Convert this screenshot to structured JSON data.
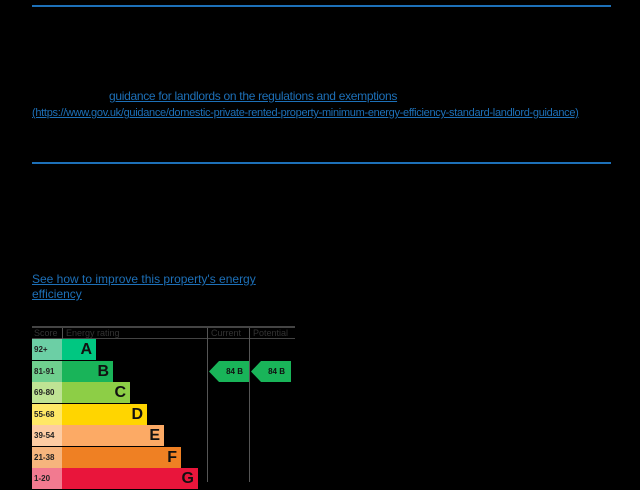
{
  "guidance": {
    "link_text": "guidance for landlords on the regulations and exemptions",
    "url_text": "(https://www.gov.uk/guidance/domestic-private-rented-property-minimum-energy-efficiency-standard-landlord-guidance)"
  },
  "improve_link": "See how to improve this property's energy efficiency",
  "epc": {
    "headers": {
      "score": "Score",
      "rating": "Energy rating",
      "current": "Current",
      "potential": "Potential"
    },
    "bands": [
      {
        "score": "92+",
        "letter": "A",
        "color": "#00c781",
        "light": "#6ccfa5"
      },
      {
        "score": "81-91",
        "letter": "B",
        "color": "#19b459",
        "light": "#6fcf8e"
      },
      {
        "score": "69-80",
        "letter": "C",
        "color": "#8dce46",
        "light": "#bfe394"
      },
      {
        "score": "55-68",
        "letter": "D",
        "color": "#ffd500",
        "light": "#ffe866"
      },
      {
        "score": "39-54",
        "letter": "E",
        "color": "#fcaa65",
        "light": "#fdcca3"
      },
      {
        "score": "21-38",
        "letter": "F",
        "color": "#ef8023",
        "light": "#f6b57d"
      },
      {
        "score": "1-20",
        "letter": "G",
        "color": "#e9153b",
        "light": "#f27a90"
      }
    ],
    "current": {
      "label": "84  B",
      "score": 84,
      "band": "B"
    },
    "potential": {
      "label": "84  B",
      "score": 84,
      "band": "B"
    }
  }
}
